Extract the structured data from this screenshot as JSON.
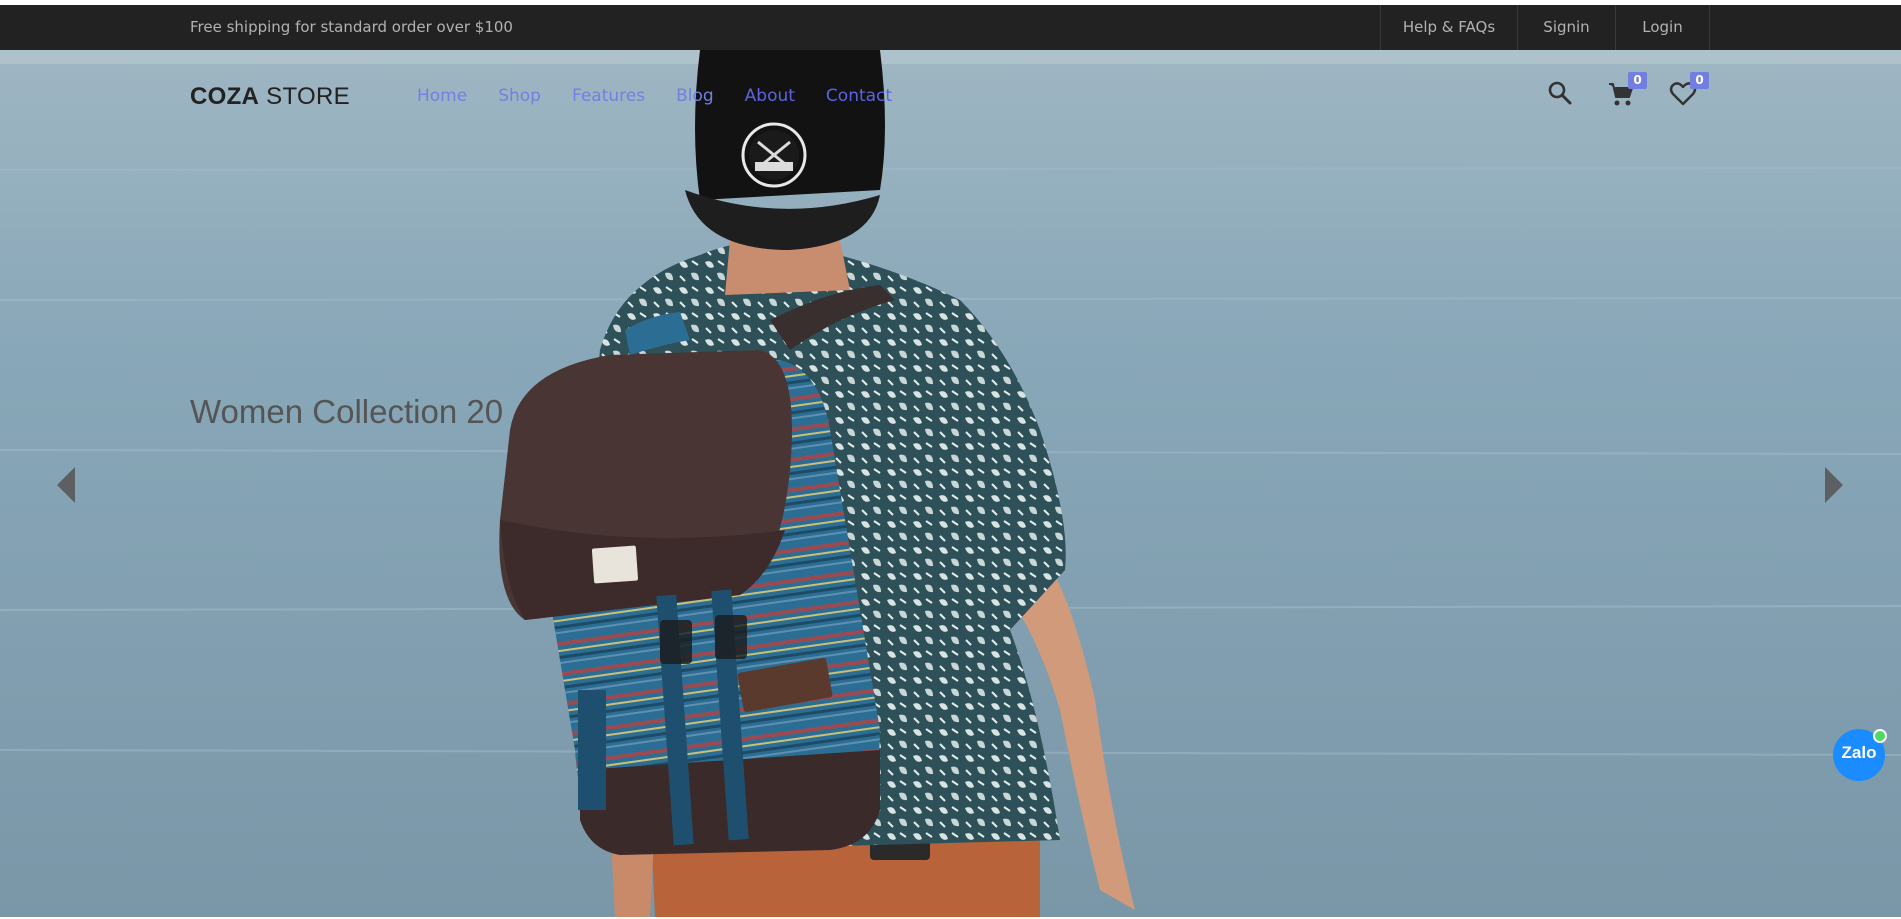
{
  "topbar": {
    "shipping_text": "Free shipping for standard order over $100",
    "links": [
      {
        "label": "Help & FAQs"
      },
      {
        "label": "Signin"
      },
      {
        "label": "Login"
      }
    ]
  },
  "header": {
    "logo_bold": "COZA",
    "logo_light": "STORE",
    "menu": [
      {
        "label": "Home",
        "color": "#7280e0"
      },
      {
        "label": "Shop",
        "color": "#7280e0"
      },
      {
        "label": "Features",
        "color": "#7280e0"
      },
      {
        "label": "Blog",
        "color": "#7280e0"
      },
      {
        "label": "About",
        "color": "#5d63e0"
      },
      {
        "label": "Contact",
        "color": "#5d63e0"
      }
    ],
    "icons": {
      "search": "search-icon",
      "cart": "cart-icon",
      "wishlist": "heart-icon"
    },
    "cart_count": "0",
    "wishlist_count": "0"
  },
  "hero": {
    "title": "Women Collection 20",
    "prev": "chevron-left-icon",
    "next": "chevron-right-icon"
  },
  "chat_widget": {
    "label": "Zalo"
  },
  "colors": {
    "accent": "#717fe0",
    "topbar_bg": "#222222",
    "sea": "#8aa8b8"
  }
}
